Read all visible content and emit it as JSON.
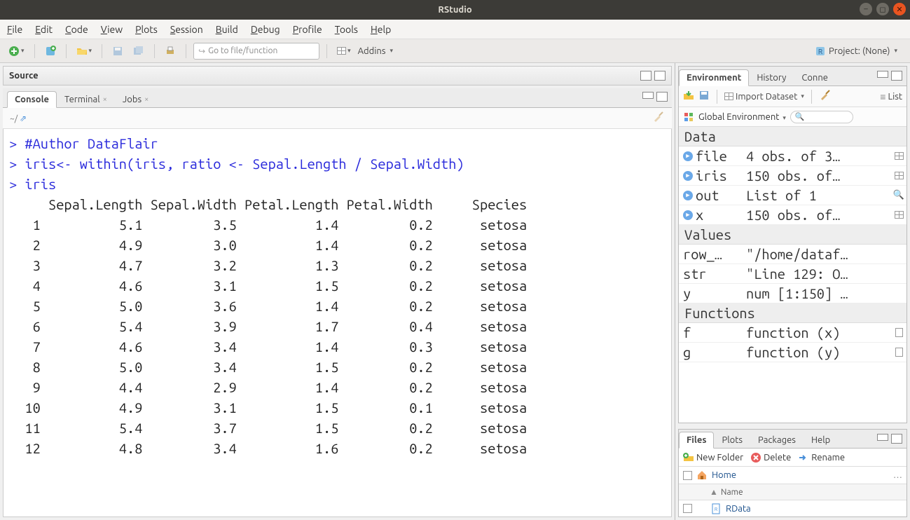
{
  "window": {
    "title": "RStudio"
  },
  "menus": [
    "File",
    "Edit",
    "Code",
    "View",
    "Plots",
    "Session",
    "Build",
    "Debug",
    "Profile",
    "Tools",
    "Help"
  ],
  "toolbar": {
    "goto_placeholder": "Go to file/function",
    "addins_label": "Addins",
    "project_label": "Project: (None)"
  },
  "source_pane": {
    "title": "Source"
  },
  "console_tabs": {
    "tabs": [
      "Console",
      "Terminal",
      "Jobs"
    ],
    "active": 0,
    "path": "~/"
  },
  "console_lines": [
    {
      "type": "cmd",
      "text": "#Author DataFlair"
    },
    {
      "type": "cmd",
      "text": "iris<- within(iris, ratio <- Sepal.Length / Sepal.Width)"
    },
    {
      "type": "cmd",
      "text": "iris"
    }
  ],
  "iris_header": [
    "",
    "Sepal.Length",
    "Sepal.Width",
    "Petal.Length",
    "Petal.Width",
    "Species"
  ],
  "iris_rows": [
    [
      "1",
      "5.1",
      "3.5",
      "1.4",
      "0.2",
      "setosa"
    ],
    [
      "2",
      "4.9",
      "3.0",
      "1.4",
      "0.2",
      "setosa"
    ],
    [
      "3",
      "4.7",
      "3.2",
      "1.3",
      "0.2",
      "setosa"
    ],
    [
      "4",
      "4.6",
      "3.1",
      "1.5",
      "0.2",
      "setosa"
    ],
    [
      "5",
      "5.0",
      "3.6",
      "1.4",
      "0.2",
      "setosa"
    ],
    [
      "6",
      "5.4",
      "3.9",
      "1.7",
      "0.4",
      "setosa"
    ],
    [
      "7",
      "4.6",
      "3.4",
      "1.4",
      "0.3",
      "setosa"
    ],
    [
      "8",
      "5.0",
      "3.4",
      "1.5",
      "0.2",
      "setosa"
    ],
    [
      "9",
      "4.4",
      "2.9",
      "1.4",
      "0.2",
      "setosa"
    ],
    [
      "10",
      "4.9",
      "3.1",
      "1.5",
      "0.1",
      "setosa"
    ],
    [
      "11",
      "5.4",
      "3.7",
      "1.5",
      "0.2",
      "setosa"
    ],
    [
      "12",
      "4.8",
      "3.4",
      "1.6",
      "0.2",
      "setosa"
    ]
  ],
  "env_tabs": {
    "tabs": [
      "Environment",
      "History",
      "Conne"
    ],
    "active": 0,
    "import_label": "Import Dataset",
    "list_label": "List",
    "scope": "Global Environment"
  },
  "env_data_hdr": "Data",
  "env_data": [
    {
      "name": "file",
      "value": "4 obs. of 3…",
      "icon": "grid"
    },
    {
      "name": "iris",
      "value": "150 obs. of…",
      "icon": "grid"
    },
    {
      "name": "out",
      "value": "List of 1",
      "icon": "search"
    },
    {
      "name": "x",
      "value": "150 obs. of…",
      "icon": "grid"
    }
  ],
  "env_values_hdr": "Values",
  "env_values": [
    {
      "name": "row_…",
      "value": "\"/home/dataf…"
    },
    {
      "name": "str",
      "value": "\"Line 129: O…"
    },
    {
      "name": "y",
      "value": "num [1:150] …"
    }
  ],
  "env_functions_hdr": "Functions",
  "env_functions": [
    {
      "name": "f",
      "value": "function (x)",
      "icon": "doc"
    },
    {
      "name": "g",
      "value": "function (y)",
      "icon": "doc"
    }
  ],
  "files_tabs": {
    "tabs": [
      "Files",
      "Plots",
      "Packages",
      "Help"
    ],
    "active": 0
  },
  "files_actions": {
    "new_folder": "New Folder",
    "delete": "Delete",
    "rename": "Rename"
  },
  "files_home": "Home",
  "files_name_hdr": "Name",
  "files_item": "RData"
}
